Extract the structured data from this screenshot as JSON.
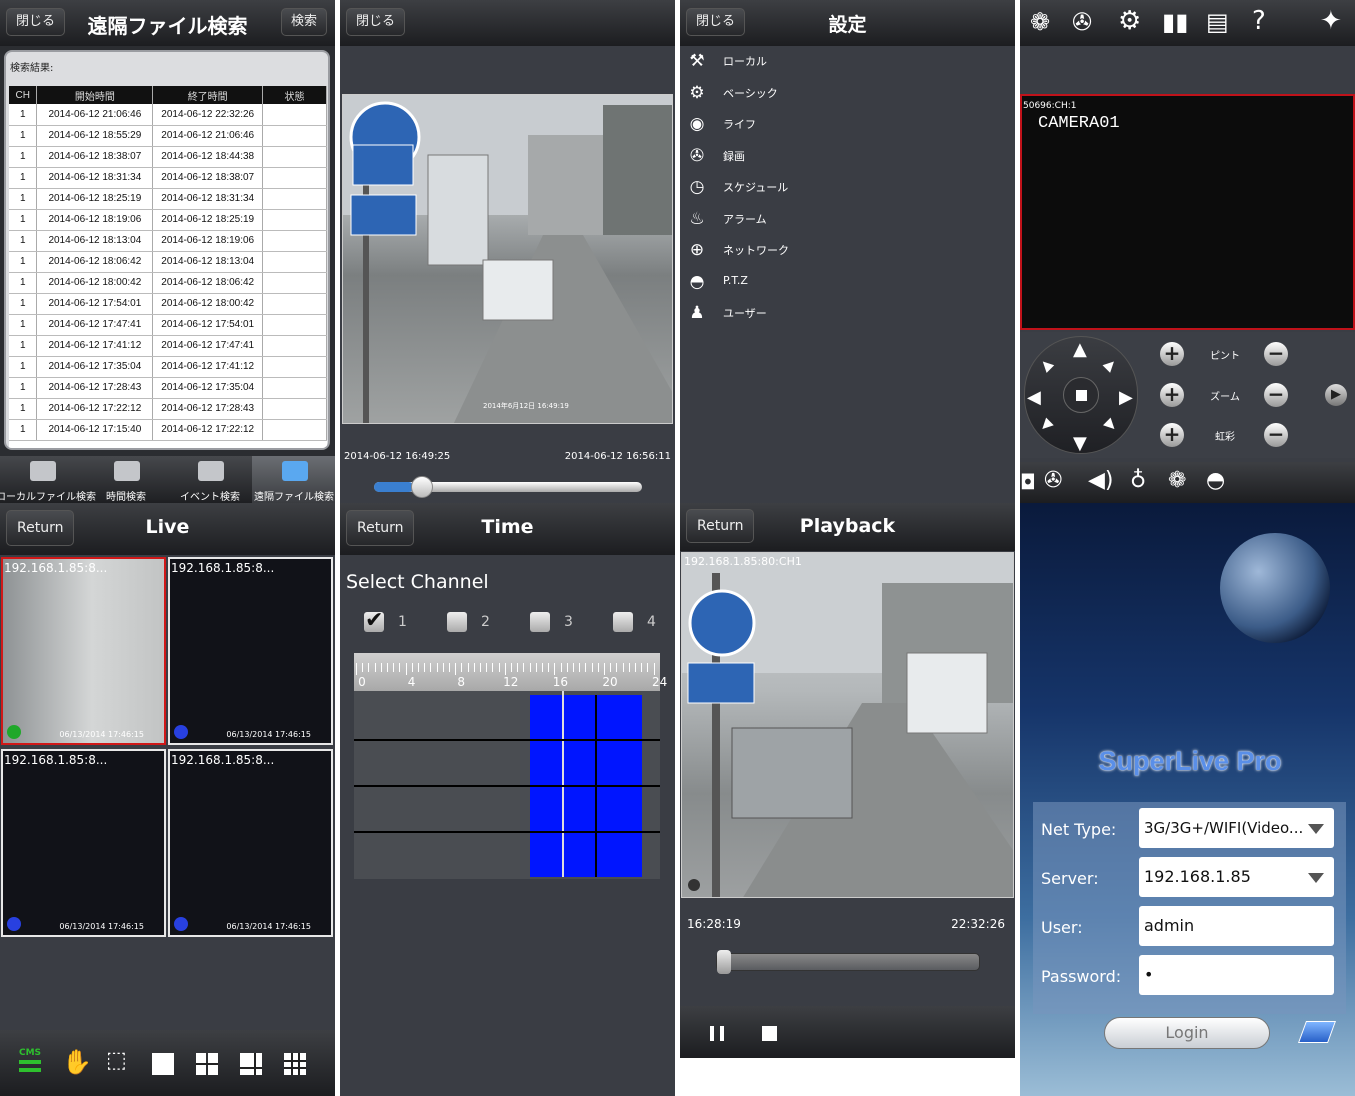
{
  "p1": {
    "close": "閉じる",
    "title": "遠隔ファイル検索",
    "search": "検索",
    "results_label": "検索結果:",
    "headers": [
      "CH",
      "開始時間",
      "終了時間",
      "状態"
    ],
    "rows": [
      [
        "1",
        "2014-06-12 21:06:46",
        "2014-06-12 22:32:26",
        ""
      ],
      [
        "1",
        "2014-06-12 18:55:29",
        "2014-06-12 21:06:46",
        ""
      ],
      [
        "1",
        "2014-06-12 18:38:07",
        "2014-06-12 18:44:38",
        ""
      ],
      [
        "1",
        "2014-06-12 18:31:34",
        "2014-06-12 18:38:07",
        ""
      ],
      [
        "1",
        "2014-06-12 18:25:19",
        "2014-06-12 18:31:34",
        ""
      ],
      [
        "1",
        "2014-06-12 18:19:06",
        "2014-06-12 18:25:19",
        ""
      ],
      [
        "1",
        "2014-06-12 18:13:04",
        "2014-06-12 18:19:06",
        ""
      ],
      [
        "1",
        "2014-06-12 18:06:42",
        "2014-06-12 18:13:04",
        ""
      ],
      [
        "1",
        "2014-06-12 18:00:42",
        "2014-06-12 18:06:42",
        ""
      ],
      [
        "1",
        "2014-06-12 17:54:01",
        "2014-06-12 18:00:42",
        ""
      ],
      [
        "1",
        "2014-06-12 17:47:41",
        "2014-06-12 17:54:01",
        ""
      ],
      [
        "1",
        "2014-06-12 17:41:12",
        "2014-06-12 17:47:41",
        ""
      ],
      [
        "1",
        "2014-06-12 17:35:04",
        "2014-06-12 17:41:12",
        ""
      ],
      [
        "1",
        "2014-06-12 17:28:43",
        "2014-06-12 17:35:04",
        ""
      ],
      [
        "1",
        "2014-06-12 17:22:12",
        "2014-06-12 17:28:43",
        ""
      ],
      [
        "1",
        "2014-06-12 17:15:40",
        "2014-06-12 17:22:12",
        ""
      ]
    ],
    "tabs": [
      "ローカルファイル検索",
      "時間検索",
      "イベント検索",
      "遠隔ファイル検索"
    ]
  },
  "p2": {
    "close": "閉じる",
    "overlay_stamp": "2014年6月12日 16:49:19",
    "start_time": "2014-06-12 16:49:25",
    "end_time": "2014-06-12 16:56:11",
    "progress": 0.15
  },
  "p3": {
    "close": "閉じる",
    "title": "設定",
    "items": [
      {
        "icon": "tools-icon",
        "glyph": "⚒",
        "label": "ローカル"
      },
      {
        "icon": "gear-icon",
        "glyph": "⚙",
        "label": "ベーシック"
      },
      {
        "icon": "camera-icon",
        "glyph": "◉",
        "label": "ライフ"
      },
      {
        "icon": "film-reel-icon",
        "glyph": "✇",
        "label": "録画"
      },
      {
        "icon": "clock-icon",
        "glyph": "◷",
        "label": "スケジュール"
      },
      {
        "icon": "alarm-bell-icon",
        "glyph": "♨",
        "label": "アラーム"
      },
      {
        "icon": "globe-icon",
        "glyph": "⊕",
        "label": "ネットワーク"
      },
      {
        "icon": "ptz-dome-icon",
        "glyph": "◓",
        "label": "P.T.Z"
      },
      {
        "icon": "user-icon",
        "glyph": "♟",
        "label": "ユーザー"
      }
    ]
  },
  "p4": {
    "video_label": "50696:CH:1",
    "camera_name": "CAMERA01",
    "rows": [
      "ピント",
      "ズーム",
      "虹彩"
    ]
  },
  "p5": {
    "return": "Return",
    "title": "Live",
    "cells": [
      {
        "label": "192.168.1.85:8...",
        "stamp": "06/13/2014 17:46:15",
        "dot": "#1fa82a"
      },
      {
        "label": "192.168.1.85:8...",
        "stamp": "06/13/2014 17:46:15",
        "dot": "#2840e0"
      },
      {
        "label": "192.168.1.85:8...",
        "stamp": "06/13/2014 17:46:15",
        "dot": "#2840e0"
      },
      {
        "label": "192.168.1.85:8...",
        "stamp": "06/13/2014 17:46:15",
        "dot": "#2840e0"
      }
    ],
    "cms": "CMS"
  },
  "p6": {
    "return": "Return",
    "title": "Time",
    "select_channel": "Select Channel",
    "channels": [
      {
        "label": "1",
        "checked": true
      },
      {
        "label": "2",
        "checked": false
      },
      {
        "label": "3",
        "checked": false
      },
      {
        "label": "4",
        "checked": false
      }
    ],
    "ticks": [
      "0",
      "4",
      "8",
      "12",
      "16",
      "20",
      "24"
    ]
  },
  "p7": {
    "return": "Return",
    "title": "Playback",
    "video_label": "192.168.1.85:80:CH1",
    "start": "16:28:19",
    "end": "22:32:26",
    "progress": 0.0
  },
  "p8": {
    "app_name": "SuperLive Pro",
    "net_type_label": "Net Type:",
    "net_type_value": "3G/3G+/WIFI(Video...",
    "server_label": "Server:",
    "server_value": "192.168.1.85",
    "user_label": "User:",
    "user_value": "admin",
    "password_label": "Password:",
    "password_value": "•",
    "login": "Login"
  }
}
